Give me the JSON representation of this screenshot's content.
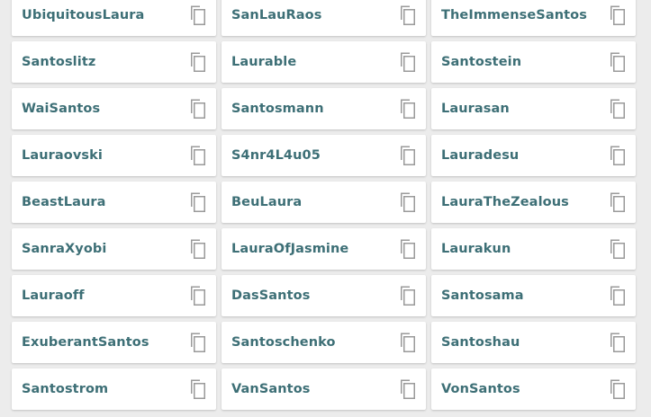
{
  "colors": {
    "background": "#ececec",
    "card": "#ffffff",
    "name_text": "#3d6f76",
    "icon": "#9a9a9a"
  },
  "icons": {
    "copy": "content-copy-icon"
  },
  "names": [
    "UbiquitousLaura",
    "SanLauRaos",
    "TheImmenseSantos",
    "Santoslitz",
    "Laurable",
    "Santostein",
    "WaiSantos",
    "Santosmann",
    "Laurasan",
    "Lauraovski",
    "S4nr4L4u05",
    "Lauradesu",
    "BeastLaura",
    "BeuLaura",
    "LauraTheZealous",
    "SanraXyobi",
    "LauraOfJasmine",
    "Laurakun",
    "Lauraoff",
    "DasSantos",
    "Santosama",
    "ExuberantSantos",
    "Santoschenko",
    "Santoshau",
    "Santostrom",
    "VanSantos",
    "VonSantos"
  ]
}
